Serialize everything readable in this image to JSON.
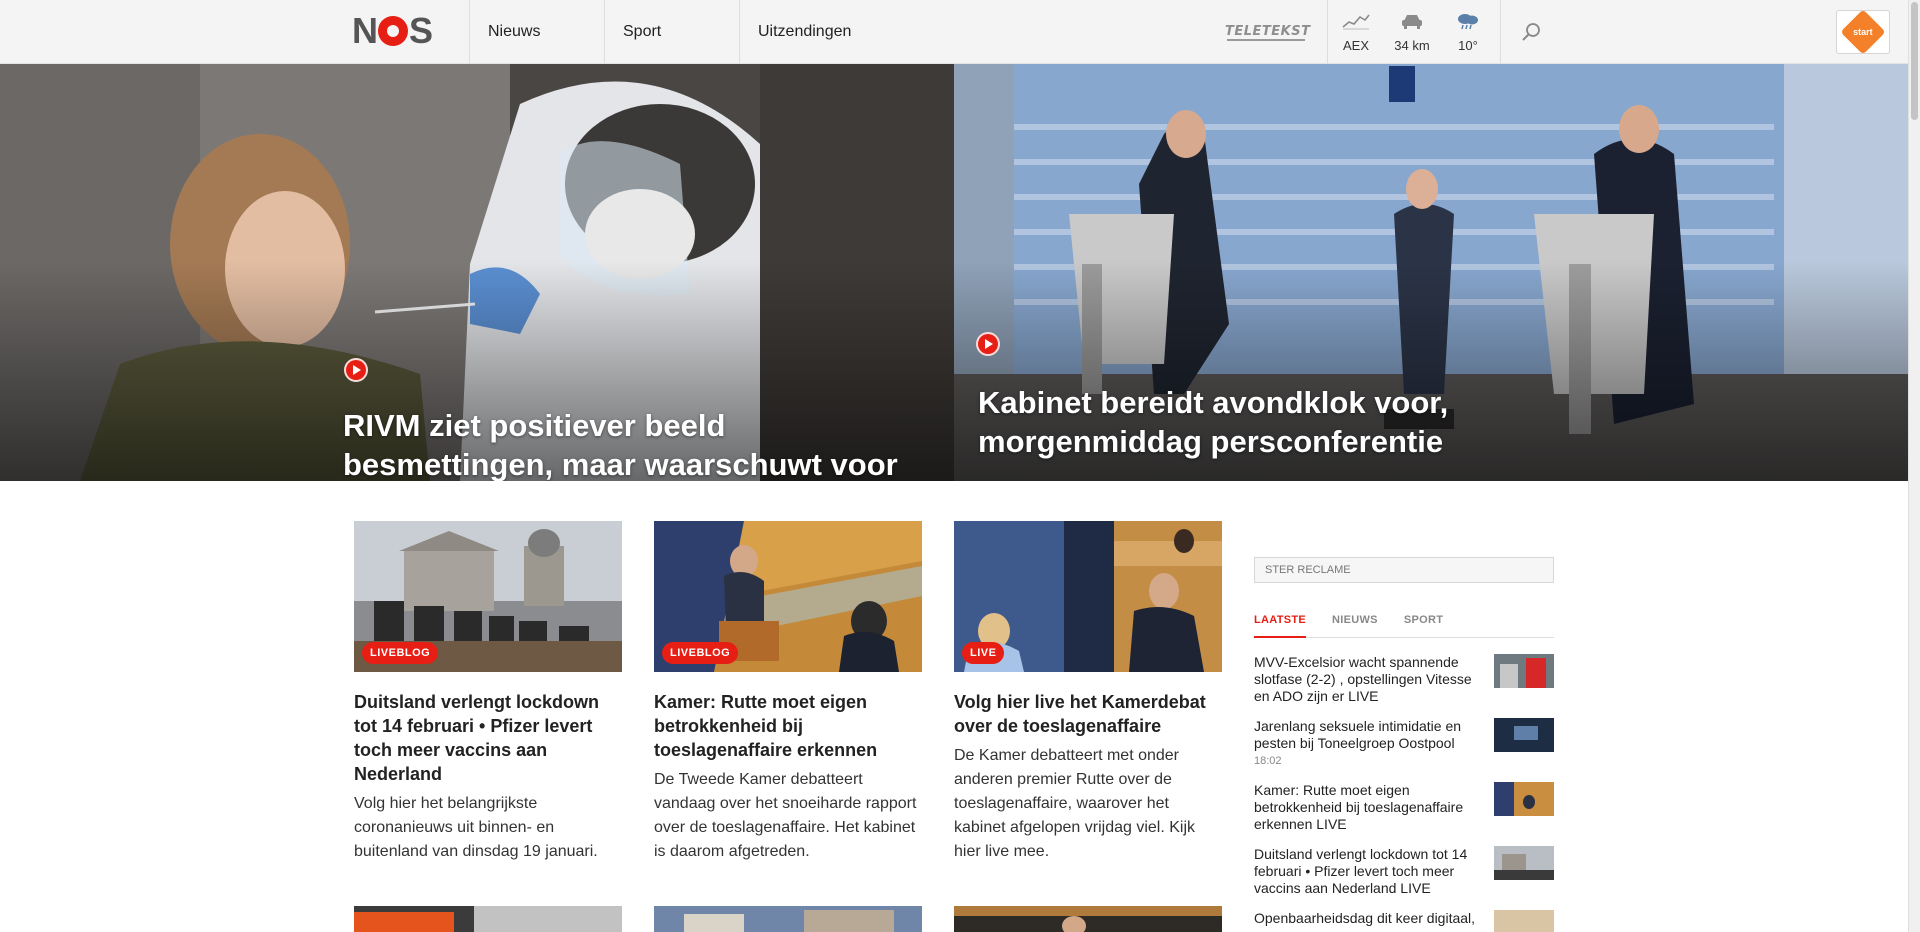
{
  "header": {
    "logo_text": "NOS",
    "nav": [
      "Nieuws",
      "Sport",
      "Uitzendingen"
    ],
    "teletekst": "TELETEKST",
    "widgets": [
      {
        "icon": "stock-chart-icon",
        "label": "AEX"
      },
      {
        "icon": "car-icon",
        "label": "34 km"
      },
      {
        "icon": "rain-cloud-icon",
        "label": "10°"
      }
    ],
    "search_icon": "search-icon",
    "npo_start": "start"
  },
  "hero": [
    {
      "title": "RIVM ziet positiever beeld besmettingen, maar waarschuwt voor Britse variant",
      "has_video": true
    },
    {
      "title": "Kabinet bereidt avondklok voor, morgenmiddag persconferentie",
      "has_video": true
    }
  ],
  "articles": [
    {
      "tag": "LIVEBLOG",
      "title": "Duitsland verlengt lockdown tot 14 februari • Pfizer levert toch meer vaccins aan Nederland",
      "description": "Volg hier het belangrijkste coronanieuws uit binnen- en buitenland van dinsdag 19 januari."
    },
    {
      "tag": "LIVEBLOG",
      "title": "Kamer: Rutte moet eigen betrokkenheid bij toeslagenaffaire erkennen",
      "description": "De Tweede Kamer debatteert vandaag over het snoeiharde rapport over de toeslagenaffaire. Het kabinet is daarom afgetreden."
    },
    {
      "tag": "LIVE",
      "title": "Volg hier live het Kamerdebat over de toeslagenaffaire",
      "description": "De Kamer debatteert met onder anderen premier Rutte over de toeslagenaffaire, waarover het kabinet afgelopen vrijdag viel. Kijk hier live mee."
    }
  ],
  "sidebar": {
    "ster": "STER RECLAME",
    "tabs": [
      "LAATSTE",
      "NIEUWS",
      "SPORT"
    ],
    "active_tab": "LAATSTE",
    "items": [
      {
        "text": "MVV-Excelsior wacht spannende slotfase (2-2) , opstellingen Vitesse en ADO zijn er LIVE",
        "time": ""
      },
      {
        "text": "Jarenlang seksuele intimidatie en pesten bij Toneelgroep Oostpool",
        "time": "18:02"
      },
      {
        "text": "Kamer: Rutte moet eigen betrokkenheid bij toeslagenaffaire erkennen LIVE",
        "time": ""
      },
      {
        "text": "Duitsland verlengt lockdown tot 14 februari • Pfizer levert toch meer vaccins aan Nederland LIVE",
        "time": ""
      },
      {
        "text": "Openbaarheidsdag dit keer digitaal,",
        "time": ""
      }
    ]
  },
  "colors": {
    "accent": "#e61e14",
    "header_bg": "#f4f4f4"
  }
}
